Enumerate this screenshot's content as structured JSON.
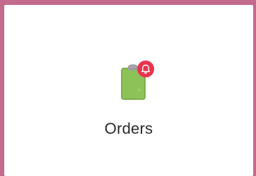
{
  "tile": {
    "label": "Orders",
    "icon": "clipboard-icon",
    "badge_icon": "bell-icon",
    "colors": {
      "border": "#c36b8c",
      "clipboard": "#8cc257",
      "clipboard_dark": "#6e9f3e",
      "clip": "#9e9e9e",
      "badge": "#e8354f"
    }
  }
}
